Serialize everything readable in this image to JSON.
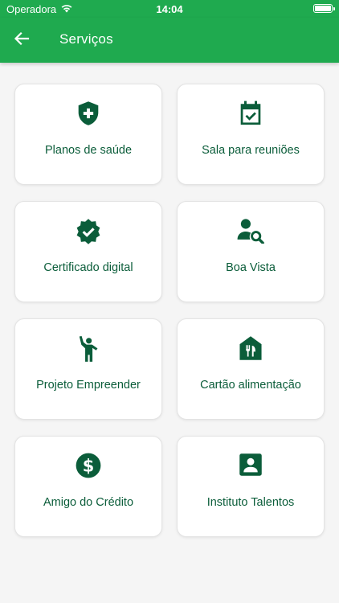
{
  "status_bar": {
    "carrier": "Operadora",
    "time": "14:04"
  },
  "header": {
    "title": "Serviços"
  },
  "services": [
    {
      "label": "Planos de saúde",
      "icon": "shield-plus-icon"
    },
    {
      "label": "Sala para reuniões",
      "icon": "calendar-check-icon"
    },
    {
      "label": "Certificado digital",
      "icon": "verified-badge-icon"
    },
    {
      "label": "Boa Vista",
      "icon": "person-search-icon"
    },
    {
      "label": "Projeto Empreender",
      "icon": "person-raising-hand-icon"
    },
    {
      "label": "Cartão alimentação",
      "icon": "house-cutlery-icon"
    },
    {
      "label": "Amigo do Crédito",
      "icon": "dollar-circle-icon"
    },
    {
      "label": "Instituto Talentos",
      "icon": "contact-card-icon"
    }
  ],
  "colors": {
    "primary": "#1faa4f",
    "icon": "#0b5d3a",
    "background": "#f5f5f5"
  }
}
